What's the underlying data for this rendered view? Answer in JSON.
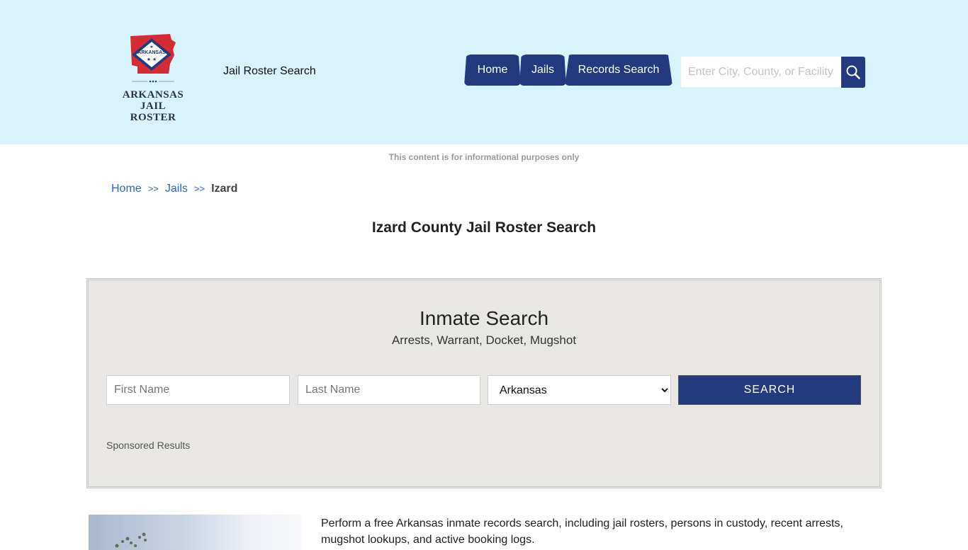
{
  "header": {
    "logo_line1": "ARKANSAS",
    "logo_line2": "JAIL ROSTER",
    "logo_flag_text": "ARKANSAS",
    "site_name": "Jail Roster Search",
    "nav": [
      {
        "label": "Home"
      },
      {
        "label": "Jails"
      },
      {
        "label": "Records Search"
      }
    ],
    "search_placeholder": "Enter City, County, or Facility",
    "search_icon": "search-icon"
  },
  "disclaimer": "This content is for informational purposes only",
  "breadcrumb": {
    "items": [
      {
        "label": "Home"
      },
      {
        "label": "Jails"
      },
      {
        "label": "Izard"
      }
    ],
    "separator": ">>"
  },
  "page_title": "Izard County Jail Roster Search",
  "inmate_search": {
    "title": "Inmate Search",
    "subtitle": "Arrests, Warrant, Docket, Mugshot",
    "first_name_placeholder": "First Name",
    "last_name_placeholder": "Last Name",
    "state_selected": "Arkansas",
    "submit_label": "SEARCH",
    "sponsored_label": "Sponsored Results"
  },
  "intro_text": "Perform a free Arkansas inmate records search, including jail rosters, persons in custody, recent arrests, mugshot lookups, and active booking logs.",
  "colors": {
    "header_bg": "#d8f3fc",
    "brand_navy": "#243a7e",
    "link_blue": "#2a6ac0",
    "panel_bg": "#e8e7e3"
  }
}
